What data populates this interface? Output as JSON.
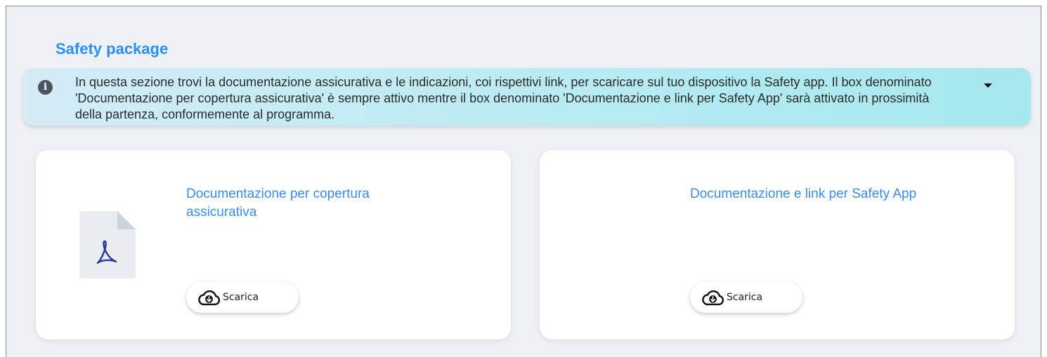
{
  "section": {
    "title": "Safety package"
  },
  "info": {
    "icon": "info-icon",
    "text": "In questa sezione trovi la documentazione assicurativa e le indicazioni, coi rispettivi link, per scaricare sul tuo dispositivo la Safety app. Il box denominato 'Documentazione per copertura assicurativa' è sempre attivo mentre il box denominato 'Documentazione e link per Safety App' sarà attivato in prossimità della partenza, conformemente al programma.",
    "toggle_icon": "caret-down-icon"
  },
  "cards": [
    {
      "title": "Documentazione per copertura assicurativa",
      "icon": "pdf-file-icon",
      "button_label": "Scarica",
      "button_icon": "cloud-download-icon"
    },
    {
      "title": "Documentazione e link per Safety App",
      "button_label": "Scarica",
      "button_icon": "cloud-download-icon"
    }
  ],
  "colors": {
    "accent": "#2d8ff0",
    "card_title": "#3a8ee6",
    "info_background": "#b6ebf2",
    "page_background": "#edf0f4",
    "pdf_red": "#223b8f"
  }
}
